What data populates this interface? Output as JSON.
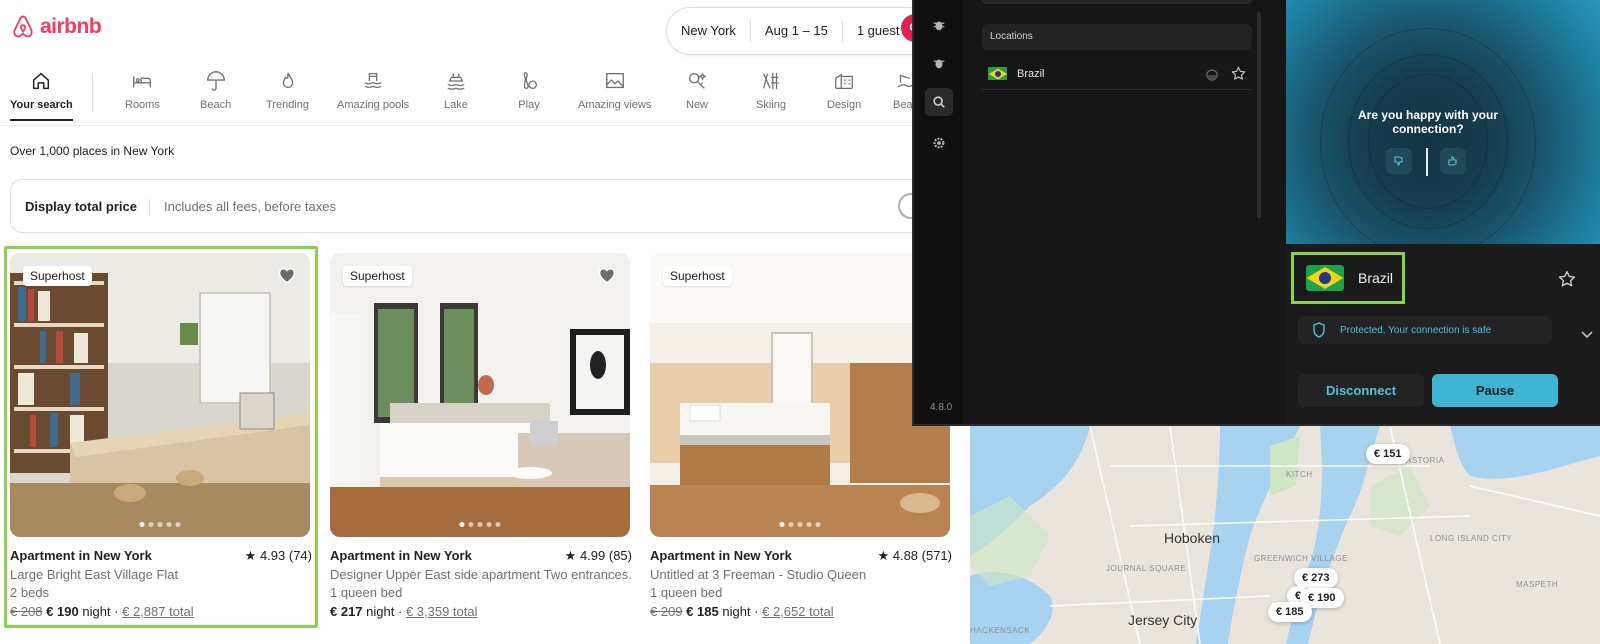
{
  "airbnb": {
    "logo_text": "airbnb",
    "search": {
      "location": "New York",
      "dates": "Aug 1 – 15",
      "guests": "1 guest"
    },
    "categories": [
      {
        "label": "Your search",
        "icon": "house-icon"
      },
      {
        "label": "Rooms",
        "icon": "bed-icon"
      },
      {
        "label": "Beach",
        "icon": "umbrella-icon"
      },
      {
        "label": "Trending",
        "icon": "flame-icon"
      },
      {
        "label": "Amazing pools",
        "icon": "pool-icon"
      },
      {
        "label": "Lake",
        "icon": "lake-icon"
      },
      {
        "label": "Play",
        "icon": "bowling-icon"
      },
      {
        "label": "Amazing views",
        "icon": "picture-icon"
      },
      {
        "label": "New",
        "icon": "sparkle-key-icon"
      },
      {
        "label": "Skiing",
        "icon": "ski-icon"
      },
      {
        "label": "Design",
        "icon": "building-icon"
      },
      {
        "label": "Beac",
        "icon": "beachfront-icon"
      }
    ],
    "places_count": "Over 1,000 places in New York",
    "total_price": {
      "label": "Display total price",
      "description": "Includes all fees, before taxes"
    },
    "listings": [
      {
        "badge": "Superhost",
        "title": "Apartment in New York",
        "rating": "4.93 (74)",
        "description": "Large Bright East Village Flat",
        "beds": "2 beds",
        "old_price": "€ 208",
        "price": "€ 190",
        "unit": "night",
        "total": "€ 2,887 total"
      },
      {
        "badge": "Superhost",
        "title": "Apartment in New York",
        "rating": "4.99 (85)",
        "description": "Designer Upper East side apartment Two entrances.",
        "beds": "1 queen bed",
        "old_price": "",
        "price": "€ 217",
        "unit": "night",
        "total": "€ 3,359 total"
      },
      {
        "badge": "Superhost",
        "title": "Apartment in New York",
        "rating": "4.88 (571)",
        "description": "Untitled at 3 Freeman - Studio Queen",
        "beds": "1 queen bed",
        "old_price": "€ 209",
        "price": "€ 185",
        "unit": "night",
        "total": "€ 2,652 total"
      }
    ],
    "map": {
      "pins": [
        "€ 151",
        "€ 273",
        "€ 190",
        "€ 185",
        "€"
      ],
      "labels": {
        "hoboken": "Hoboken",
        "jersey_city": "Jersey City",
        "long_island_city": "LONG ISLAND CITY",
        "astoria": "ASTORIA",
        "greenwich_village": "GREENWICH VILLAGE",
        "journal_square": "JOURNAL SQUARE",
        "maspeth": "MASPETH",
        "hackensack": "HACKENSACK",
        "kitchen": "KITCH"
      }
    }
  },
  "vpn": {
    "version": "4.8.0",
    "section_label": "Locations",
    "location_row": "Brazil",
    "question": "Are you happy with your connection?",
    "selected_country": "Brazil",
    "status": "Protected. Your connection is safe",
    "disconnect_label": "Disconnect",
    "pause_label": "Pause",
    "accent": "#40b5d3"
  }
}
